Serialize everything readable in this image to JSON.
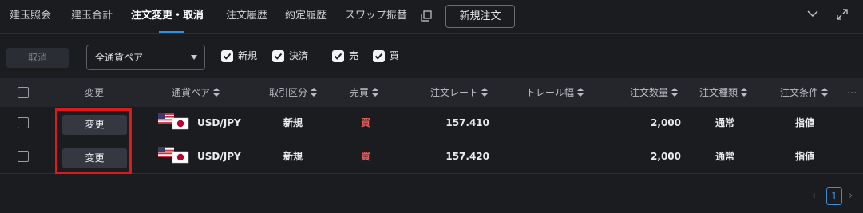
{
  "tabs": [
    {
      "label": "建玉照会"
    },
    {
      "label": "建玉合計"
    },
    {
      "label": "注文変更・取消",
      "active": true
    },
    {
      "label": "注文履歴"
    },
    {
      "label": "約定履歴"
    },
    {
      "label": "スワップ振替"
    }
  ],
  "new_order_label": "新規注文",
  "toolbar": {
    "cancel_label": "取消",
    "pair_select_value": "全通貨ペア",
    "filters": [
      {
        "label": "新規",
        "checked": true
      },
      {
        "label": "決済",
        "checked": true
      },
      {
        "label": "売",
        "checked": true
      },
      {
        "label": "買",
        "checked": true
      }
    ]
  },
  "columns": {
    "edit": "変更",
    "pair": "通貨ペア",
    "trade_type": "取引区分",
    "side": "売買",
    "rate": "注文レート",
    "trail": "トレール幅",
    "qty": "注文数量",
    "order_type": "注文種類",
    "condition": "注文条件",
    "more": "⋯"
  },
  "rows": [
    {
      "edit": "変更",
      "pair": "USD/JPY",
      "trade_type": "新規",
      "side": "買",
      "rate": "157.410",
      "trail": "",
      "qty": "2,000",
      "order_type": "通常",
      "condition": "指値"
    },
    {
      "edit": "変更",
      "pair": "USD/JPY",
      "trade_type": "新規",
      "side": "買",
      "rate": "157.420",
      "trail": "",
      "qty": "2,000",
      "order_type": "通常",
      "condition": "指値"
    }
  ],
  "pagination": {
    "prev": "‹",
    "current": "1",
    "next": "›"
  },
  "colors": {
    "accent": "#3a8fd6",
    "buy": "#e25a5a",
    "highlight": "#e0181c"
  }
}
